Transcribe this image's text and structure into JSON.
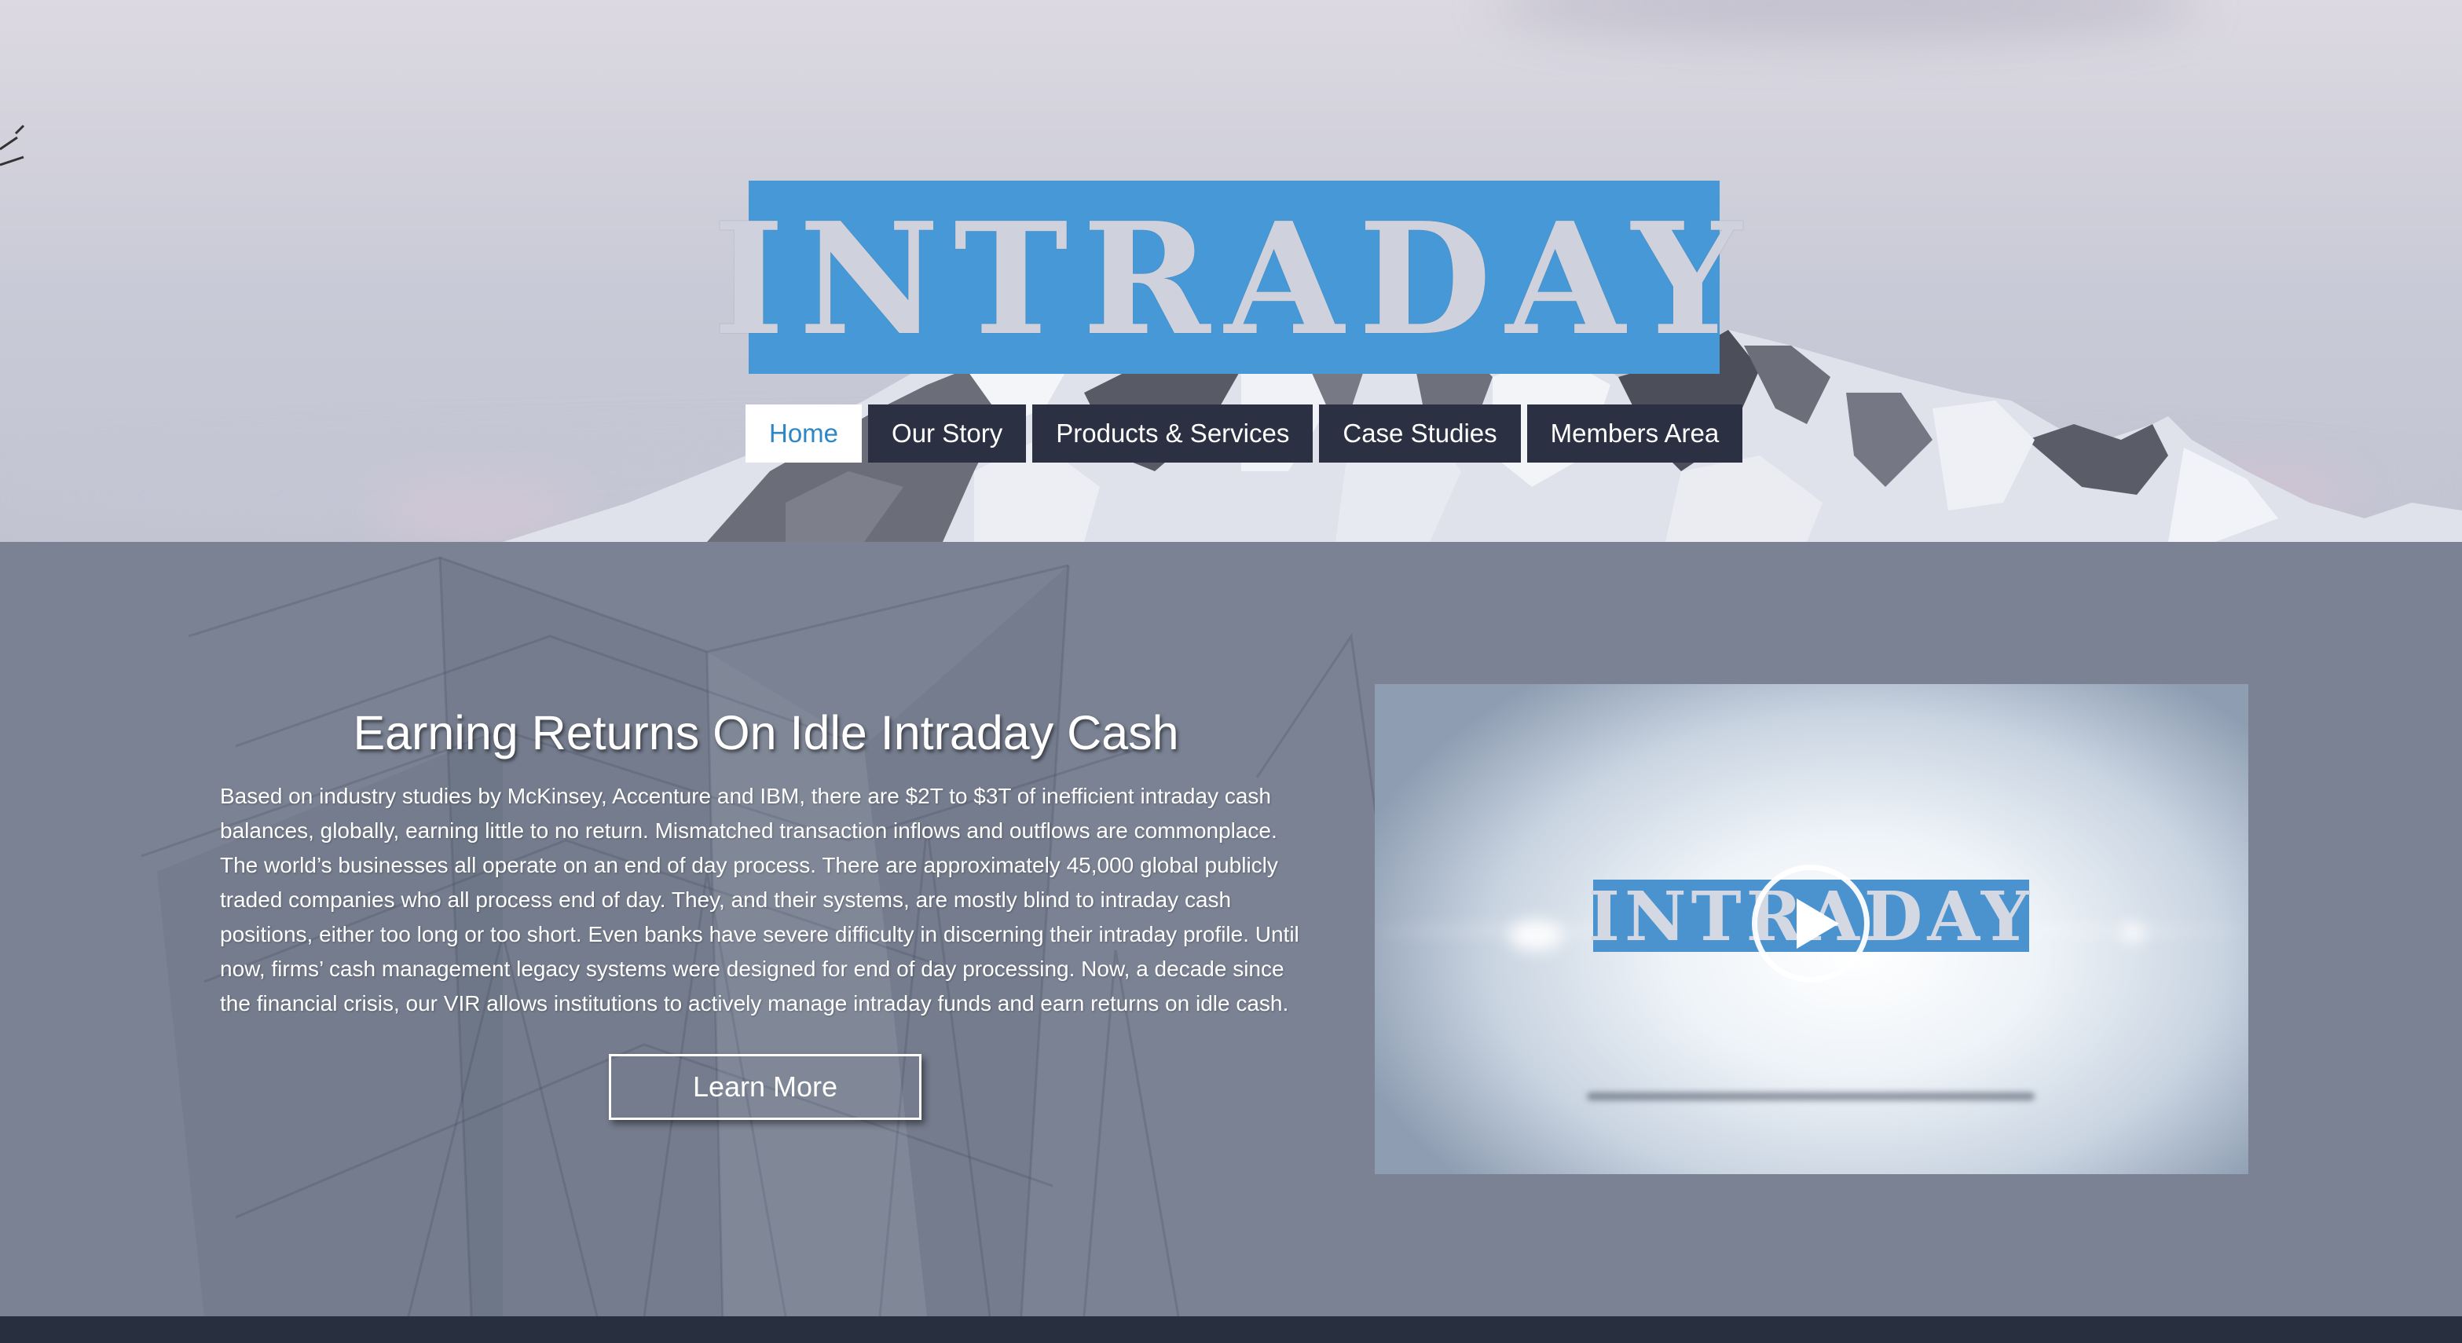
{
  "logo": {
    "text": "INTRADAY"
  },
  "nav": {
    "items": [
      {
        "label": "Home",
        "active": true
      },
      {
        "label": "Our Story",
        "active": false
      },
      {
        "label": "Products & Services",
        "active": false
      },
      {
        "label": "Case Studies",
        "active": false
      },
      {
        "label": "Members Area",
        "active": false
      }
    ]
  },
  "main": {
    "headline": "Earning Returns On Idle Intraday Cash",
    "body": "Based on industry studies by McKinsey, Accenture and IBM, there are $2T to $3T of inefficient intraday cash balances, globally, earning little to no return. Mismatched transaction inflows and outflows are commonplace. The world’s businesses all operate on an end of day process. There are approximately 45,000 global publicly traded companies who all process end of day. They, and their systems, are mostly blind to intraday cash positions, either too long or too short. Even banks have severe difficulty in discerning their intraday profile. Until now, firms’ cash management legacy systems were designed for end of day processing. Now, a decade since the financial crisis, our VIR allows institutions to actively manage intraday funds and earn returns on idle cash.",
    "cta_label": "Learn More"
  },
  "video": {
    "logo_text": "INTRADAY",
    "play_icon": "play-icon"
  },
  "colors": {
    "logo_blue": "#4699d6",
    "nav_dark": "#2b3142",
    "nav_active_text": "#2d86c6",
    "section_bg": "#7a8293",
    "footer_bg": "#283040"
  }
}
